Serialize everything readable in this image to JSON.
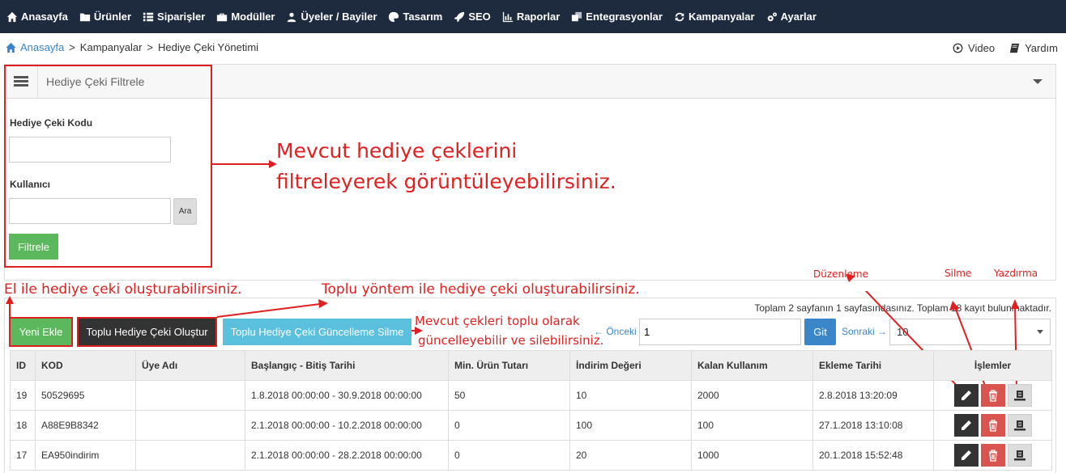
{
  "nav": [
    {
      "label": "Anasayfa",
      "icon": "home-icon"
    },
    {
      "label": "Ürünler",
      "icon": "folder-icon"
    },
    {
      "label": "Siparişler",
      "icon": "list-icon"
    },
    {
      "label": "Modüller",
      "icon": "briefcase-icon"
    },
    {
      "label": "Üyeler / Bayiler",
      "icon": "users-icon"
    },
    {
      "label": "Tasarım",
      "icon": "palette-icon"
    },
    {
      "label": "SEO",
      "icon": "rocket-icon"
    },
    {
      "label": "Raporlar",
      "icon": "chart-icon"
    },
    {
      "label": "Entegrasyonlar",
      "icon": "clone-icon"
    },
    {
      "label": "Kampanyalar",
      "icon": "refresh-icon"
    },
    {
      "label": "Ayarlar",
      "icon": "gears-icon"
    }
  ],
  "breadcrumb": {
    "home": "Anasayfa",
    "sep1": ">",
    "item1": "Kampanyalar",
    "sep2": ">",
    "item2": "Hediye Çeki Yönetimi"
  },
  "header_links": {
    "video": "Video",
    "help": "Yardım"
  },
  "filter": {
    "title": "Hediye Çeki Filtrele",
    "code_label": "Hediye Çeki Kodu",
    "code_value": "",
    "user_label": "Kullanıcı",
    "user_value": "",
    "search_button": "Ara",
    "filter_button": "Filtrele"
  },
  "annotations": {
    "filter_note_line1": "Mevcut hediye çeklerini",
    "filter_note_line2": "filtreleyerek görüntüleyebilirsiniz.",
    "manual_note": "El ile hediye çeki oluşturabilirsiniz.",
    "bulk_note": "Toplu yöntem ile hediye çeki oluşturabilirsiniz.",
    "bulk_update_line1": "Mevcut çekleri toplu olarak",
    "bulk_update_line2": "güncelleyebilir ve silebilirsiniz.",
    "edit_note": "Düzenleme",
    "delete_note": "Silme",
    "print_note": "Yazdırma"
  },
  "list": {
    "summary": "Toplam 2 sayfanın 1 sayfasındasınız. Toplam 18 kayıt bulunmaktadır.",
    "add_button": "Yeni Ekle",
    "bulk_create_button": "Toplu Hediye Çeki Oluştur",
    "bulk_update_button": "Toplu Hediye Çeki Güncelleme Silme",
    "prev": "← Önceki",
    "page_value": "1",
    "go_button": "Git",
    "next": "Sonraki →",
    "page_size": "10"
  },
  "table": {
    "headers": [
      "ID",
      "KOD",
      "Üye Adı",
      "Başlangıç - Bitiş Tarihi",
      "Min. Ürün Tutarı",
      "İndirim Değeri",
      "Kalan Kullanım",
      "Ekleme Tarihi",
      "İşlemler"
    ],
    "rows": [
      [
        "19",
        "50529695",
        "",
        "1.8.2018 00:00:00 - 30.9.2018 00:00:00",
        "50",
        "10",
        "2000",
        "2.8.2018 13:20:09"
      ],
      [
        "18",
        "A88E9B8342",
        "",
        "2.1.2018 00:00:00 - 10.2.2018 00:00:00",
        "0",
        "100",
        "100",
        "27.1.2018 13:10:08"
      ],
      [
        "17",
        "EA950indirim",
        "",
        "2.1.2018 00:00:00 - 28.2.2018 00:00:00",
        "0",
        "20",
        "1000",
        "20.1.2018 15:52:48"
      ]
    ]
  },
  "colors": {
    "nav_bg": "#1e2b3f",
    "annotation": "#e02020",
    "green": "#5cb85c",
    "blue": "#5bc0de",
    "delete": "#d9534f",
    "link": "#3a86c8"
  }
}
